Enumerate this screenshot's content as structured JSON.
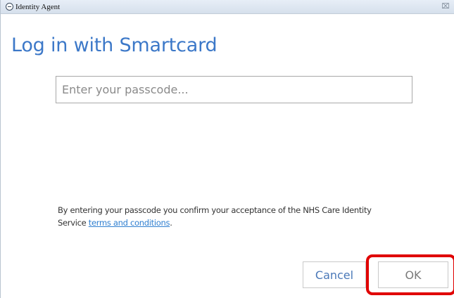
{
  "window": {
    "title": "Identity Agent",
    "close_glyph": "⌧"
  },
  "main": {
    "heading": "Log in with Smartcard",
    "passcode_placeholder": "Enter your passcode...",
    "passcode_value": "",
    "terms_text": "By entering your passcode you confirm your acceptance of the NHS Care Identity Service",
    "terms_link": "terms and conditions",
    "terms_end": "."
  },
  "buttons": {
    "cancel_label": "Cancel",
    "ok_label": "OK"
  },
  "icons": {
    "app_icon": "identity-agent-icon",
    "close_icon": "close-icon"
  },
  "colors": {
    "heading": "#3c78c8",
    "link": "#2f7fd0",
    "highlight": "#e00000"
  }
}
